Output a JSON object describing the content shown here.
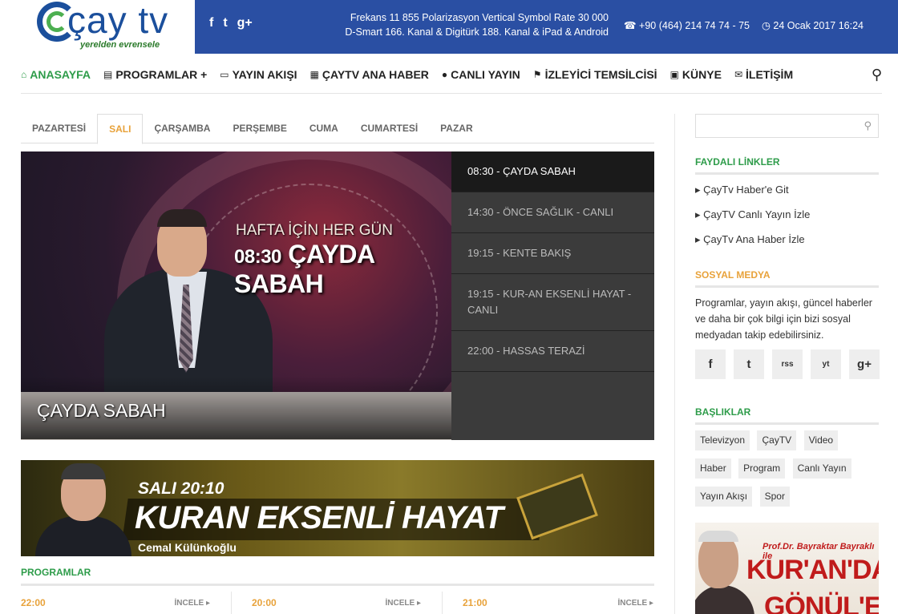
{
  "header": {
    "logo_text": "çay tv",
    "logo_sub": "yerelden evrensele",
    "social_top": [
      "f",
      "t",
      "g+"
    ],
    "freq_line1": "Frekans 11 855 Polarizasyon Vertical Symbol Rate 30 000",
    "freq_line2": "D-Smart 166. Kanal & Digitürk 188. Kanal & iPad & Android",
    "phone": "+90 (464) 214 74 74 - 75",
    "date": "24 Ocak 2017 16:24"
  },
  "nav": {
    "items": [
      {
        "label": "ANASAYFA",
        "icon": "⌂",
        "active": true
      },
      {
        "label": "PROGRAMLAR +",
        "icon": "▤"
      },
      {
        "label": "YAYIN AKIŞI",
        "icon": "▭"
      },
      {
        "label": "ÇAYTV ANA HABER",
        "icon": "▦"
      },
      {
        "label": "CANLI YAYIN",
        "icon": "●"
      },
      {
        "label": "İZLEYİCİ TEMSİLCİSİ",
        "icon": "⚑"
      },
      {
        "label": "KÜNYE",
        "icon": "▣"
      },
      {
        "label": "İLETİŞİM",
        "icon": "✉"
      }
    ],
    "search_icon": "⚲"
  },
  "tabs": [
    "PAZARTESİ",
    "SALI",
    "ÇARŞAMBA",
    "PERŞEMBE",
    "CUMA",
    "CUMARTESİ",
    "PAZAR"
  ],
  "featured": {
    "overlay_line1": "HAFTA İÇİN HER GÜN",
    "overlay_time": "08:30",
    "overlay_name": "ÇAYDA SABAH",
    "title": "ÇAYDA SABAH"
  },
  "schedule": [
    {
      "label": "08:30 - ÇAYDA SABAH"
    },
    {
      "label": "14:30 - ÖNCE SAĞLIK - CANLI"
    },
    {
      "label": "19:15 - KENTE BAKIŞ"
    },
    {
      "label": "19:15 - KUR-AN EKSENLİ HAYAT - CANLI"
    },
    {
      "label": "22:00 - HASSAS TERAZİ"
    }
  ],
  "banner": {
    "time": "SALI 20:10",
    "title": "KURAN EKSENLİ HAYAT",
    "name": "Cemal Külünkoğlu"
  },
  "programs": {
    "title": "PROGRAMLAR",
    "items": [
      {
        "time": "22:00",
        "more": "İNCELE ▸"
      },
      {
        "time": "20:00",
        "more": "İNCELE ▸"
      },
      {
        "time": "21:00",
        "more": "İNCELE ▸"
      }
    ]
  },
  "sidebar": {
    "search_icon": "⚲",
    "links_title": "FAYDALI LİNKLER",
    "links": [
      "ÇayTv Haber'e Git",
      "ÇayTV Canlı Yayın İzle",
      "ÇayTv Ana Haber İzle"
    ],
    "social_title": "SOSYAL MEDYA",
    "about": "Programlar, yayın akışı, güncel haberler ve daha bir çok bilgi için bizi sosyal medyadan takip edebilirsiniz.",
    "social": [
      "f",
      "t",
      "rss",
      "yt",
      "g+"
    ],
    "tags_title": "BAŞLIKLAR",
    "tags": [
      "Televizyon",
      "ÇayTV",
      "Video",
      "Haber",
      "Program",
      "Canlı Yayın",
      "Yayın Akışı",
      "Spor"
    ],
    "ad_sub": "Prof.Dr. Bayraktar Bayraklı ile",
    "ad_t1": "KUR'AN'DAN",
    "ad_t2": "GÖNÜL'E"
  },
  "colors": {
    "brand_blue": "#2a4fa3",
    "accent_green": "#2e9c4a",
    "accent_orange": "#e8a23a"
  }
}
